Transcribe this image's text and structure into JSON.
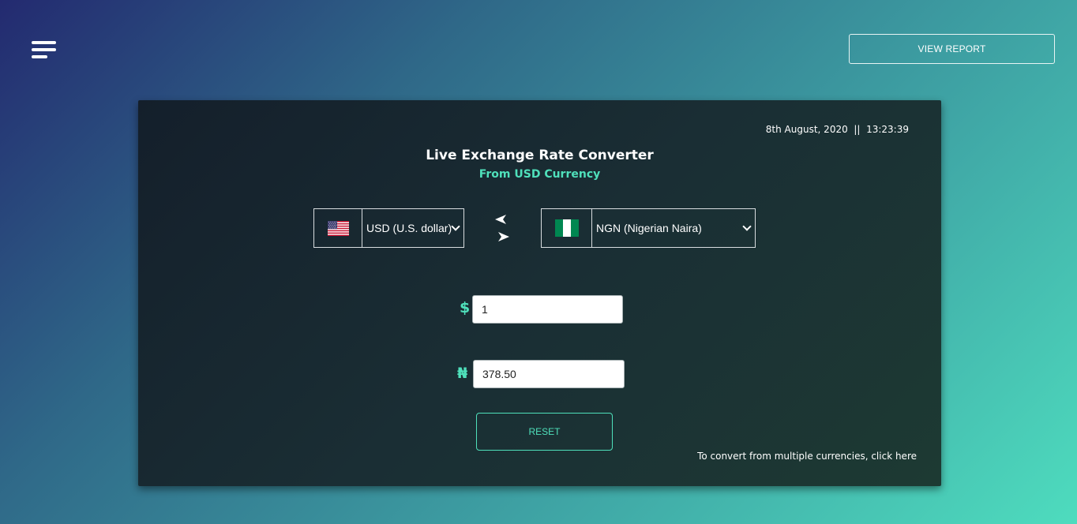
{
  "header": {
    "view_report_label": "VIEW REPORT"
  },
  "converter": {
    "date": "8th August, 2020",
    "separator": "||",
    "time": "13:23:39",
    "title": "Live Exchange Rate Converter",
    "subtitle": "From USD Currency",
    "from_currency": {
      "label": "USD (U.S. dollar)",
      "flag_icon": "us-flag-icon",
      "symbol": "$",
      "amount": "1"
    },
    "to_currency": {
      "label": "NGN (Nigerian Naira)",
      "flag_icon": "nigeria-flag-icon",
      "symbol": "₦",
      "amount": "378.50"
    },
    "reset_label": "RESET",
    "multi_currency_link": "To convert from multiple currencies, click here"
  },
  "colors": {
    "accent": "#4fe0bb",
    "card_bg": "#172730",
    "background_start": "#232a70",
    "background_end": "#4edcbe"
  }
}
